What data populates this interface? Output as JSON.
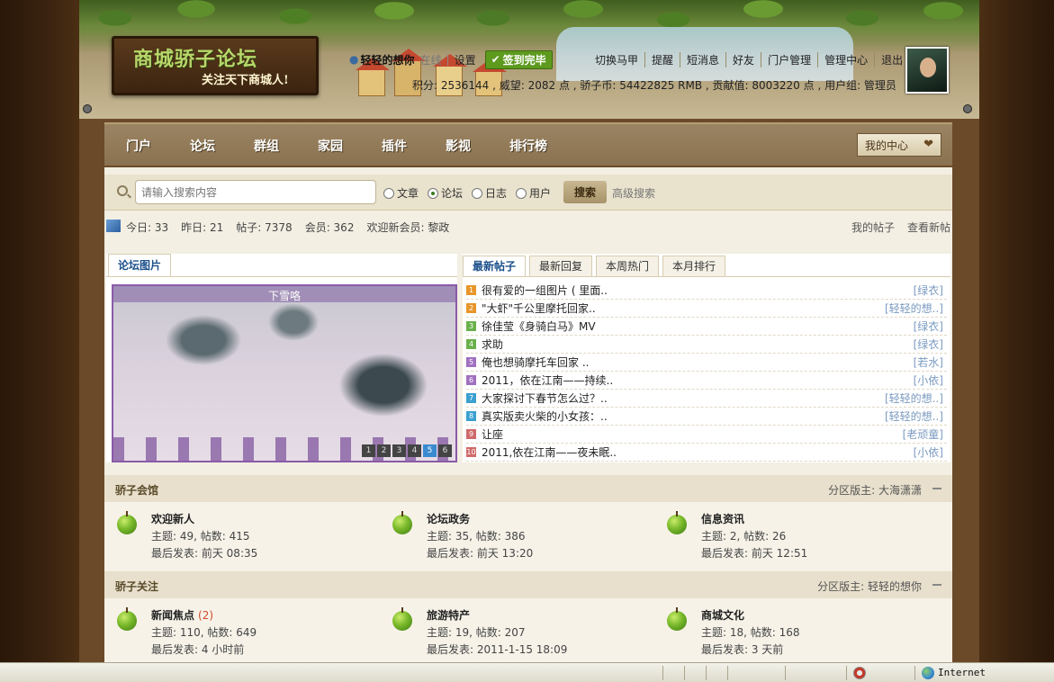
{
  "site": {
    "title": "商城骄子论坛",
    "slogan": "关注天下商城人!"
  },
  "user": {
    "name": "轻轻的想你",
    "online": "在线",
    "settings": "设置",
    "signin": "签到完毕",
    "stats_prefix": "积分: 2536144 , 威望: 2082 点 , 骄子币: 54422825 RMB , 贡献值: 8003220 点 , 用户组: 管理员"
  },
  "userlinks": [
    "切换马甲",
    "提醒",
    "短消息",
    "好友",
    "门户管理",
    "管理中心",
    "退出"
  ],
  "nav": {
    "items": [
      "门户",
      "论坛",
      "群组",
      "家园",
      "插件",
      "影视",
      "排行榜"
    ],
    "my_center": "我的中心"
  },
  "search": {
    "placeholder": "请输入搜索内容",
    "options": [
      "文章",
      "论坛",
      "日志",
      "用户"
    ],
    "selected": "论坛",
    "button": "搜索",
    "advanced": "高级搜索"
  },
  "stats": {
    "today": "今日: 33",
    "yesterday": "昨日: 21",
    "posts": "帖子: 7378",
    "members": "会员: 362",
    "newest": "欢迎新会员: 黎政",
    "my_posts": "我的帖子",
    "view_new": "查看新帖"
  },
  "pictures": {
    "tab": "论坛图片",
    "caption": "下雪咯",
    "pages": [
      "1",
      "2",
      "3",
      "4",
      "5",
      "6"
    ],
    "active_page": "5"
  },
  "posts_tabs": [
    "最新帖子",
    "最新回复",
    "本周热门",
    "本月排行"
  ],
  "posts": [
    {
      "n": "1",
      "color": "#e8962a",
      "title": "很有爱的一组图片 ( 里面..",
      "author": "[绿衣]"
    },
    {
      "n": "2",
      "color": "#e8962a",
      "title": "\"大虾\"千公里摩托回家..",
      "author": "[轻轻的想..]"
    },
    {
      "n": "3",
      "color": "#6ab04a",
      "title": "徐佳莹《身骑白马》MV",
      "author": "[绿衣]"
    },
    {
      "n": "4",
      "color": "#6ab04a",
      "title": "求助",
      "author": "[绿衣]"
    },
    {
      "n": "5",
      "color": "#a070c0",
      "title": "俺也想骑摩托车回家 ..",
      "author": "[若水]"
    },
    {
      "n": "6",
      "color": "#a070c0",
      "title": "2011，依在江南——持续..",
      "author": "[小依]"
    },
    {
      "n": "7",
      "color": "#3aa0d0",
      "title": "大家探讨下春节怎么过？..",
      "author": "[轻轻的想..]"
    },
    {
      "n": "8",
      "color": "#3aa0d0",
      "title": "真实版卖火柴的小女孩：..",
      "author": "[轻轻的想..]"
    },
    {
      "n": "9",
      "color": "#d06a6a",
      "title": "让座",
      "author": "[老顽童]"
    },
    {
      "n": "10",
      "color": "#d06a6a",
      "title": "2011,依在江南——夜未眠..",
      "author": "[小依]"
    }
  ],
  "sections": [
    {
      "title": "骄子会馆",
      "moderator": "分区版主: 大海潇潇",
      "forums": [
        {
          "name": "欢迎新人",
          "new": "",
          "stats": "主题: 49, 帖数: 415",
          "last": "最后发表: 前天 08:35"
        },
        {
          "name": "论坛政务",
          "new": "",
          "stats": "主题: 35, 帖数: 386",
          "last": "最后发表: 前天 13:20"
        },
        {
          "name": "信息资讯",
          "new": "",
          "stats": "主题: 2, 帖数: 26",
          "last": "最后发表: 前天 12:51"
        }
      ]
    },
    {
      "title": "骄子关注",
      "moderator": "分区版主: 轻轻的想你",
      "forums": [
        {
          "name": "新闻焦点",
          "new": "(2)",
          "stats": "主题: 110, 帖数: 649",
          "last": "最后发表: 4 小时前"
        },
        {
          "name": "旅游特产",
          "new": "",
          "stats": "主题: 19, 帖数: 207",
          "last": "最后发表: 2011-1-15 18:09"
        },
        {
          "name": "商城文化",
          "new": "",
          "stats": "主题: 18, 帖数: 168",
          "last": "最后发表: 3 天前"
        }
      ]
    }
  ],
  "statusbar": {
    "zone": "Internet"
  }
}
